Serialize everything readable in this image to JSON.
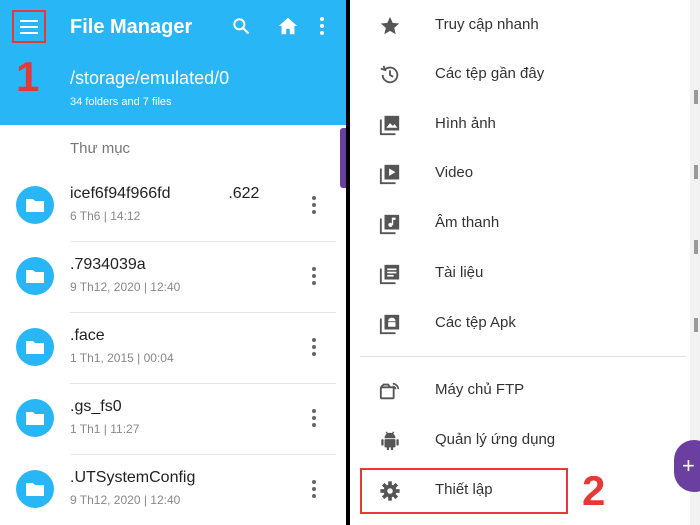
{
  "left": {
    "title": "File Manager",
    "path": "/storage/emulated/0",
    "summary": "34 folders and 7 files",
    "section_label": "Thư mục",
    "step_marker": "1",
    "files": [
      {
        "name": "icef6f94f966fd             .622",
        "meta": "6 Th6 | 14:12"
      },
      {
        "name": ".7934039a",
        "meta": "9 Th12, 2020 | 12:40"
      },
      {
        "name": ".face",
        "meta": "1 Th1, 2015 | 00:04"
      },
      {
        "name": ".gs_fs0",
        "meta": "1 Th1 | 11:27"
      },
      {
        "name": ".UTSystemConfig",
        "meta": "9 Th12, 2020 | 12:40"
      }
    ]
  },
  "drawer": {
    "step_marker": "2",
    "items": [
      {
        "label": "Truy cập nhanh",
        "icon": "star-icon"
      },
      {
        "label": "Các tệp gần đây",
        "icon": "history-icon"
      },
      {
        "label": "Hình ảnh",
        "icon": "image-icon"
      },
      {
        "label": "Video",
        "icon": "video-icon"
      },
      {
        "label": "Âm thanh",
        "icon": "music-icon"
      },
      {
        "label": "Tài liệu",
        "icon": "document-icon"
      },
      {
        "label": "Các tệp Apk",
        "icon": "apk-icon"
      },
      {
        "label": "Máy chủ FTP",
        "icon": "ftp-icon"
      },
      {
        "label": "Quản lý ứng dụng",
        "icon": "android-icon"
      },
      {
        "label": "Thiết lập",
        "icon": "gear-icon"
      }
    ]
  },
  "colors": {
    "accent": "#29b6f6",
    "highlight": "#e53935",
    "fab": "#6a3fa0"
  }
}
